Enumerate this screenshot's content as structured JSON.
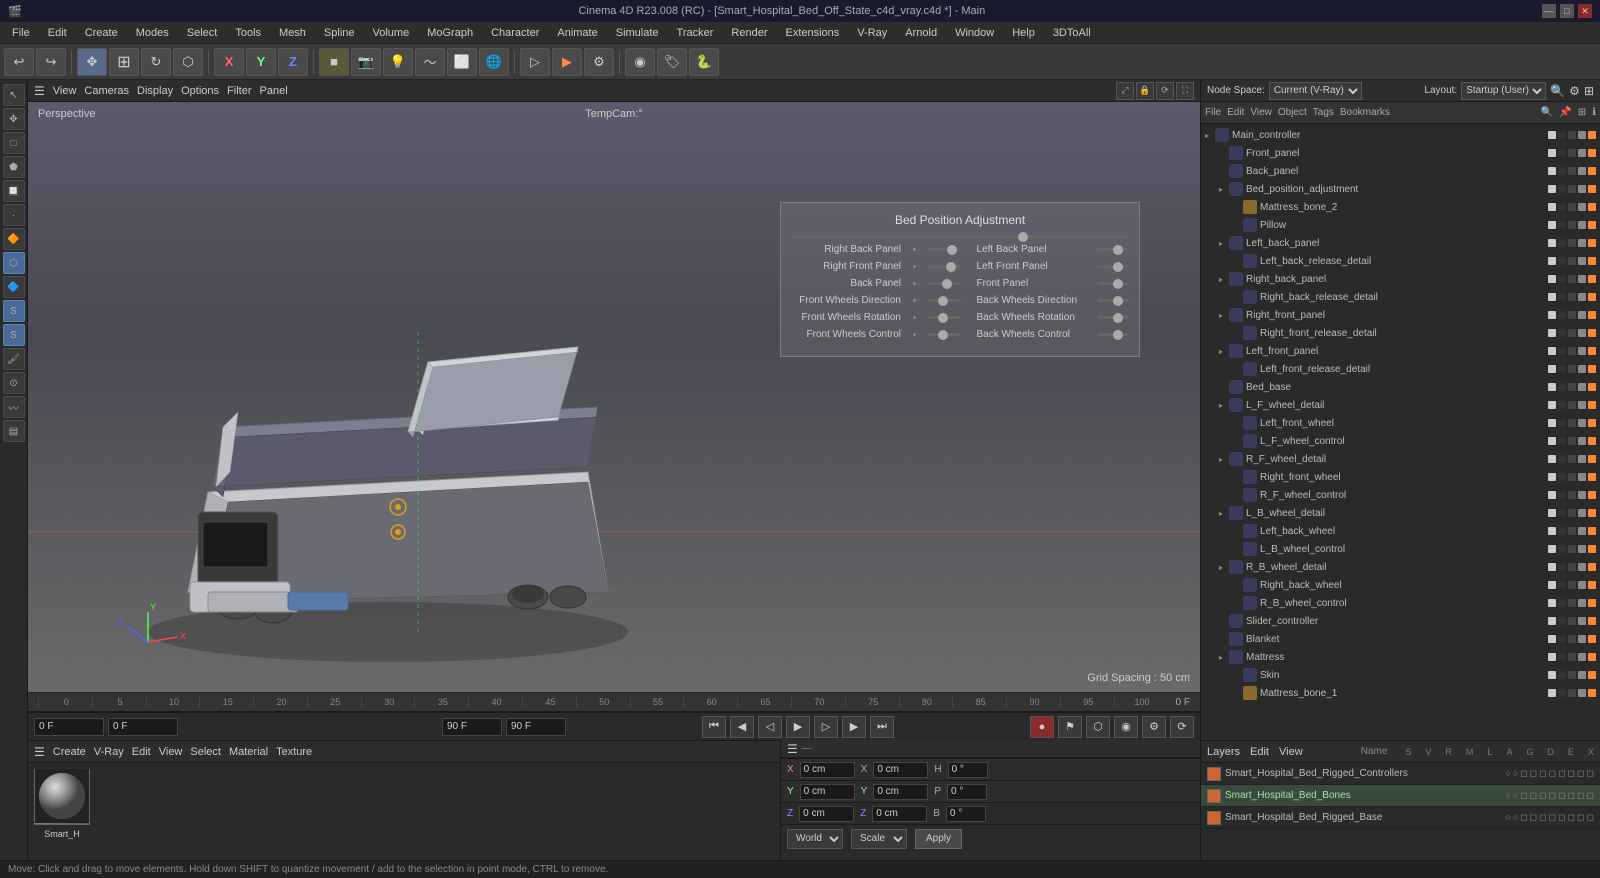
{
  "titlebar": {
    "title": "Cinema 4D R23.008 (RC) - [Smart_Hospital_Bed_Off_State_c4d_vray.c4d *] - Main",
    "win_min": "—",
    "win_max": "□",
    "win_close": "✕"
  },
  "menubar": {
    "items": [
      "File",
      "Edit",
      "Create",
      "Modes",
      "Select",
      "Tools",
      "Mesh",
      "Spline",
      "Volume",
      "MoGraph",
      "Character",
      "Animate",
      "Simulate",
      "Tracker",
      "Render",
      "Extensions",
      "V-Ray",
      "Arnold",
      "Window",
      "Help",
      "3DToAll"
    ]
  },
  "toolbar": {
    "undo_label": "↩",
    "redo_label": "↪",
    "move_label": "✥",
    "scale_label": "⊞",
    "rotate_label": "↻",
    "live_label": "⬡",
    "x_label": "X",
    "y_label": "Y",
    "z_label": "Z",
    "snap_label": "⊕",
    "render_label": "▷",
    "render_settings": "⚙",
    "cube_label": "■"
  },
  "viewport": {
    "label": "Perspective",
    "camera": "TempCam:°",
    "grid_spacing": "Grid Spacing : 50 cm",
    "header_items": [
      "View",
      "Cameras",
      "Display",
      "Options",
      "Filter",
      "Panel"
    ]
  },
  "control_panel": {
    "title": "Bed Position Adjustment",
    "rows": [
      {
        "left": "Right Back Panel",
        "right": "Left Back Panel"
      },
      {
        "left": "Right Front Panel",
        "right": "Left Front Panel"
      },
      {
        "left": "Back Panel",
        "right": "Front Panel"
      },
      {
        "left": "Front Wheels Direction",
        "right": "Back Wheels Direction"
      },
      {
        "left": "Front Wheels Rotation",
        "right": "Back Wheels Rotation"
      },
      {
        "left": "Front Wheels Control",
        "right": "Back Wheels Control"
      }
    ]
  },
  "timeline": {
    "ruler_marks": [
      "0",
      "5",
      "10",
      "15",
      "20",
      "25",
      "30",
      "35",
      "40",
      "45",
      "50",
      "55",
      "60",
      "65",
      "70",
      "75",
      "80",
      "85",
      "90",
      "95",
      "100"
    ],
    "frame_display": "0 F",
    "start_frame": "0 F",
    "current_frame": "0 F",
    "end_frame": "90 F",
    "max_frame": "90 F"
  },
  "coordinates": {
    "x_pos": "0 cm",
    "y_pos": "0 cm",
    "z_pos": "0 cm",
    "x_size": "0 cm",
    "y_size": "0 cm",
    "z_size": "0 cm",
    "h": "0 °",
    "p": "0 °",
    "b": "0 °"
  },
  "transform_bar": {
    "world_label": "World",
    "scale_label": "Scale",
    "apply_label": "Apply"
  },
  "right_panel": {
    "node_space_label": "Node Space:",
    "node_space_value": "Current (V-Ray)",
    "layout_label": "Layout:",
    "layout_value": "Startup (User)",
    "toolbar_items": [
      "File",
      "Edit",
      "View",
      "Object",
      "Tags",
      "Bookmarks"
    ],
    "search_icon": "🔍"
  },
  "scene_tree": {
    "items": [
      {
        "name": "Main_controller",
        "level": 0,
        "type": "null",
        "arrow": "▸",
        "selected": false
      },
      {
        "name": "Front_panel",
        "level": 1,
        "type": "null",
        "arrow": "",
        "selected": false
      },
      {
        "name": "Back_panel",
        "level": 1,
        "type": "null",
        "arrow": "",
        "selected": false
      },
      {
        "name": "Bed_position_adjustment",
        "level": 1,
        "type": "null",
        "arrow": "▸",
        "selected": false
      },
      {
        "name": "Mattress_bone_2",
        "level": 2,
        "type": "bone",
        "arrow": "",
        "selected": false,
        "highlight": "purple"
      },
      {
        "name": "Pillow",
        "level": 2,
        "type": "null",
        "arrow": "",
        "selected": false
      },
      {
        "name": "Left_back_panel",
        "level": 1,
        "type": "null",
        "arrow": "▸",
        "selected": false
      },
      {
        "name": "Left_back_release_detail",
        "level": 2,
        "type": "null",
        "arrow": "",
        "selected": false
      },
      {
        "name": "Right_back_panel",
        "level": 1,
        "type": "null",
        "arrow": "▸",
        "selected": false
      },
      {
        "name": "Right_back_release_detail",
        "level": 2,
        "type": "null",
        "arrow": "",
        "selected": false
      },
      {
        "name": "Right_front_panel",
        "level": 1,
        "type": "null",
        "arrow": "▸",
        "selected": false
      },
      {
        "name": "Right_front_release_detail",
        "level": 2,
        "type": "null",
        "arrow": "",
        "selected": false
      },
      {
        "name": "Left_front_panel",
        "level": 1,
        "type": "null",
        "arrow": "▸",
        "selected": false
      },
      {
        "name": "Left_front_release_detail",
        "level": 2,
        "type": "null",
        "arrow": "",
        "selected": false
      },
      {
        "name": "Bed_base",
        "level": 1,
        "type": "null",
        "arrow": "",
        "selected": false
      },
      {
        "name": "L_F_wheel_detail",
        "level": 1,
        "type": "null",
        "arrow": "▸",
        "selected": false
      },
      {
        "name": "Left_front_wheel",
        "level": 2,
        "type": "null",
        "arrow": "",
        "selected": false
      },
      {
        "name": "L_F_wheel_control",
        "level": 2,
        "type": "null",
        "arrow": "",
        "selected": false
      },
      {
        "name": "R_F_wheel_detail",
        "level": 1,
        "type": "null",
        "arrow": "▸",
        "selected": false
      },
      {
        "name": "Right_front_wheel",
        "level": 2,
        "type": "null",
        "arrow": "",
        "selected": false
      },
      {
        "name": "R_F_wheel_control",
        "level": 2,
        "type": "null",
        "arrow": "",
        "selected": false
      },
      {
        "name": "L_B_wheel_detail",
        "level": 1,
        "type": "null",
        "arrow": "▸",
        "selected": false
      },
      {
        "name": "Left_back_wheel",
        "level": 2,
        "type": "null",
        "arrow": "",
        "selected": false
      },
      {
        "name": "L_B_wheel_control",
        "level": 2,
        "type": "null",
        "arrow": "",
        "selected": false
      },
      {
        "name": "R_B_wheel_detail",
        "level": 1,
        "type": "null",
        "arrow": "▸",
        "selected": false
      },
      {
        "name": "Right_back_wheel",
        "level": 2,
        "type": "null",
        "arrow": "",
        "selected": false
      },
      {
        "name": "R_B_wheel_control",
        "level": 2,
        "type": "null",
        "arrow": "",
        "selected": false
      },
      {
        "name": "Slider_controller",
        "level": 1,
        "type": "null",
        "arrow": "",
        "selected": false
      },
      {
        "name": "Blanket",
        "level": 1,
        "type": "null",
        "arrow": "",
        "selected": false
      },
      {
        "name": "Mattress",
        "level": 1,
        "type": "null",
        "arrow": "▸",
        "selected": false
      },
      {
        "name": "Skin",
        "level": 2,
        "type": "null",
        "arrow": "",
        "selected": false
      },
      {
        "name": "Mattress_bone_1",
        "level": 2,
        "type": "bone",
        "arrow": "",
        "selected": false
      }
    ]
  },
  "material_editor": {
    "header_items": [
      "Create",
      "V-Ray",
      "Edit",
      "View",
      "Select",
      "Material",
      "Texture"
    ],
    "mat_name": "Smart_H"
  },
  "layers": {
    "header_items": [
      "Layers",
      "Edit",
      "View"
    ],
    "name_col": "Name",
    "items": [
      {
        "name": "Smart_Hospital_Bed_Rigged_Controllers",
        "color": "#cc6633"
      },
      {
        "name": "Smart_Hospital_Bed_Bones",
        "color": "#cc6633",
        "highlighted": true
      },
      {
        "name": "Smart_Hospital_Bed_Rigged_Base",
        "color": "#cc6633"
      }
    ]
  },
  "statusbar": {
    "text": "Move: Click and drag to move elements. Hold down SHIFT to quantize movement / add to the selection in point mode, CTRL to remove."
  }
}
